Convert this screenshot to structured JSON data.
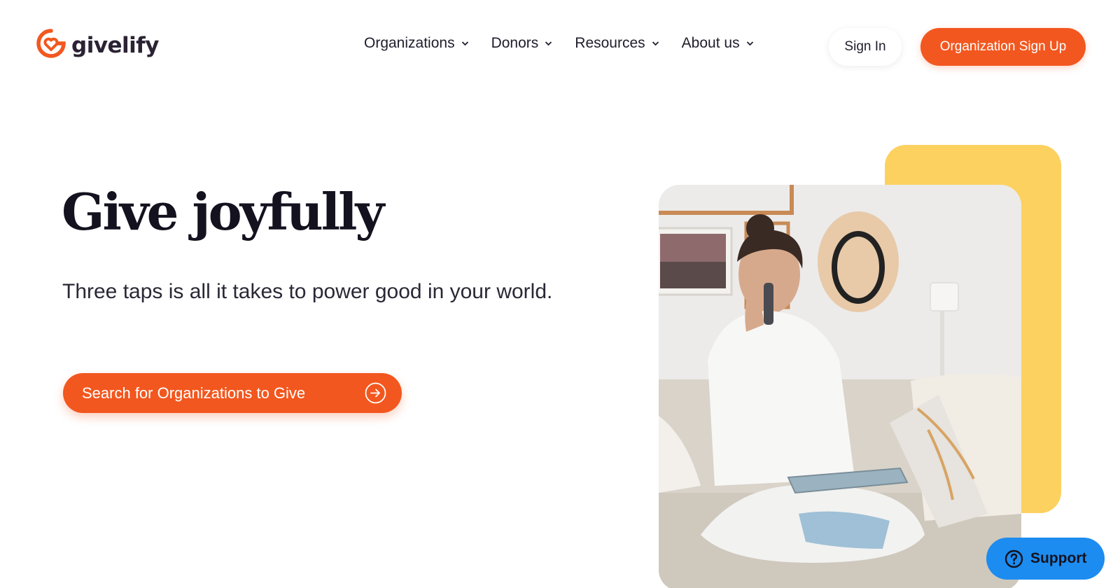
{
  "header": {
    "logo_text": "givelify",
    "logo_icon": "givelify-heart-logo-icon",
    "nav": [
      {
        "label": "Organizations",
        "icon": "chevron-down-icon"
      },
      {
        "label": "Donors",
        "icon": "chevron-down-icon"
      },
      {
        "label": "Resources",
        "icon": "chevron-down-icon"
      },
      {
        "label": "About us",
        "icon": "chevron-down-icon"
      }
    ],
    "sign_in_label": "Sign In",
    "org_signup_label": "Organization Sign Up"
  },
  "hero": {
    "title": "Give joyfully",
    "subtitle": "Three taps is all it takes to power good in your world.",
    "cta_label": "Search for Organizations to Give",
    "cta_icon": "arrow-right-circle-icon"
  },
  "support": {
    "label": "Support",
    "icon": "question-circle-icon"
  },
  "colors": {
    "brand_orange": "#f2571f",
    "accent_yellow": "#fdd160",
    "support_blue": "#1c8cf0",
    "text_dark": "#14121e"
  }
}
